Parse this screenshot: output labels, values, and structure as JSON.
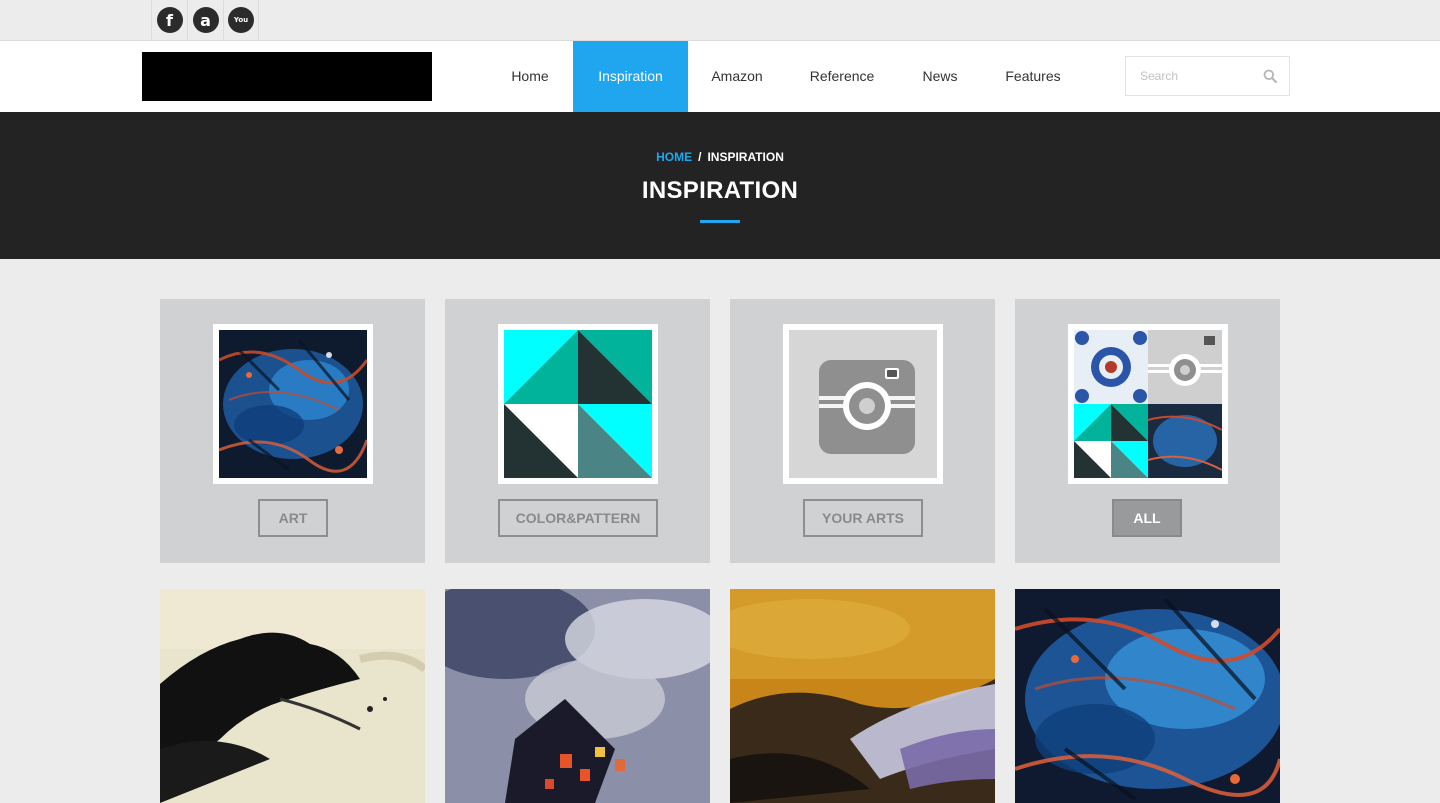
{
  "social": [
    {
      "name": "facebook",
      "glyph": "f"
    },
    {
      "name": "amazon",
      "glyph": "a"
    },
    {
      "name": "youtube",
      "glyph": "You"
    }
  ],
  "nav": {
    "items": [
      {
        "label": "Home",
        "active": false
      },
      {
        "label": "Inspiration",
        "active": true
      },
      {
        "label": "Amazon",
        "active": false
      },
      {
        "label": "Reference",
        "active": false
      },
      {
        "label": "News",
        "active": false
      },
      {
        "label": "Features",
        "active": false
      }
    ],
    "search_placeholder": "Search"
  },
  "hero": {
    "breadcrumb_home": "HOME",
    "breadcrumb_sep": "/",
    "breadcrumb_current": "INSPIRATION",
    "title": "INSPIRATION"
  },
  "categories": [
    {
      "label": "ART",
      "active": false
    },
    {
      "label": "COLOR&PATTERN",
      "active": false
    },
    {
      "label": "YOUR ARTS",
      "active": false
    },
    {
      "label": "ALL",
      "active": true
    }
  ],
  "colors": {
    "accent": "#1fa6ef",
    "dark_band": "#232323",
    "card_bg": "#d0d1d2",
    "teal": "#00b39a",
    "cyan": "#00ffff",
    "dark_slate": "#233333"
  }
}
